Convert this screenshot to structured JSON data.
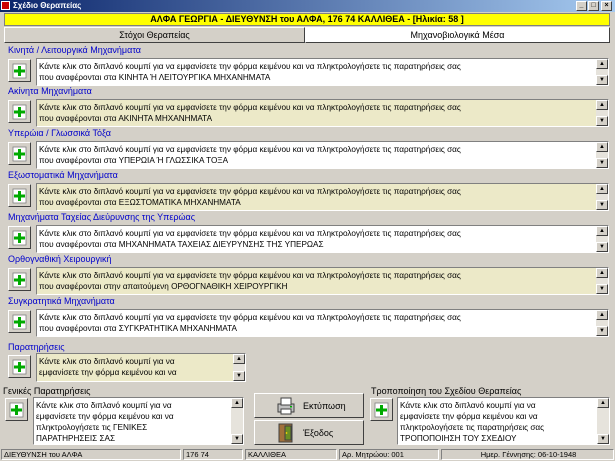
{
  "window": {
    "title": "Σχέδιο Θεραπείας"
  },
  "patient_header": "ΑΛΦΑ ΓΕΩΡΓΙΑ - ΔΙΕΥΘΥΝΣΗ του ΑΛΦΑ, 176 74 ΚΑΛΛΙΘΕΑ - [Ηλικία: 58 ]",
  "tabs": [
    {
      "label": "Στόχοι Θεραπείας",
      "active": false
    },
    {
      "label": "Μηχανοβιολογικά Μέσα",
      "active": true
    }
  ],
  "sections": [
    {
      "label": "Κινητά / Λειτουργικά Μηχανήματα",
      "line1": "Κάντε κλικ στο διπλανό κουμπί για να εμφανίσετε την φόρμα κειμένου και να πληκτρολογήσετε τις παρατηρήσεις σας",
      "line2": "που αναφέρονται στα ΚΙΝΗΤΑ Ή ΛΕΙΤΟΥΡΓΙΚΑ ΜΗΧΑΝΗΜΑΤΑ",
      "bg": "white"
    },
    {
      "label": "Ακίνητα Μηχανήματα",
      "line1": "Κάντε κλικ στο διπλανό κουμπί για να εμφανίσετε την φόρμα κειμένου και να πληκτρολογήσετε τις παρατηρήσεις σας",
      "line2": "που αναφέρονται στα ΑΚΙΝΗΤΑ ΜΗΧΑΝΗΜΑΤΑ",
      "bg": "beige"
    },
    {
      "label": "Υπερώια / Γλωσσικά Τόξα",
      "line1": "Κάντε κλικ στο διπλανό κουμπί για να εμφανίσετε την φόρμα κειμένου και να πληκτρολογήσετε τις παρατηρήσεις σας",
      "line2": "που αναφέρονται στα ΥΠΕΡΩΙΑ Ή ΓΛΩΣΣΙΚΑ ΤΟΞΑ",
      "bg": "white"
    },
    {
      "label": "Εξωστοματικά Μηχανήματα",
      "line1": "Κάντε κλικ στο διπλανό κουμπί για να εμφανίσετε την φόρμα κειμένου και να πληκτρολογήσετε τις παρατηρήσεις σας",
      "line2": "που αναφέρονται στα ΕΞΩΣΤΟΜΑΤΙΚΑ ΜΗΧΑΝΗΜΑΤΑ",
      "bg": "beige"
    },
    {
      "label": "Μηχανήματα Ταχείας Διεύρυνσης της Υπερώας",
      "line1": "Κάντε κλικ στο διπλανό κουμπί για να εμφανίσετε την φόρμα κειμένου και να πληκτρολογήσετε τις παρατηρήσεις σας",
      "line2": "που αναφέρονται στα ΜΗΧΑΝΗΜΑΤΑ ΤΑΧΕΙΑΣ ΔΙΕΥΡΥΝΣΗΣ ΤΗΣ ΥΠΕΡΩΑΣ",
      "bg": "white"
    },
    {
      "label": "Ορθογναθική Χειρουργική",
      "line1": "Κάντε κλικ στο διπλανό κουμπί για να εμφανίσετε την φόρμα κειμένου και να πληκτρολογήσετε τις παρατηρήσεις σας",
      "line2": "που αναφέρονται στην απαιτούμενη ΟΡΘΟΓΝΑΘΙΚΗ ΧΕΙΡΟΥΡΓΙΚΗ",
      "bg": "beige"
    },
    {
      "label": "Συγκρατητικά Μηχανήματα",
      "line1": "Κάντε κλικ στο διπλανό κουμπί για να εμφανίσετε την φόρμα κειμένου και να πληκτρολογήσετε τις παρατηρήσεις σας",
      "line2": "που αναφέρονται στα ΣΥΓΚΡΑΤΗΤΙΚΑ ΜΗΧΑΝΗΜΑΤΑ",
      "bg": "white"
    }
  ],
  "observations": {
    "label": "Παρατηρήσεις",
    "line1": "Κάντε κλικ στο διπλανό κουμπί για να",
    "line2": "εμφανίσετε την φόρμα κειμένου και να"
  },
  "general": {
    "label": "Γενικές Παρατηρήσεις",
    "lines": [
      "Κάντε κλικ στο διπλανό κουμπί για να",
      "εμφανίσετε την φόρμα κειμένου και να",
      "πληκτρολογήσετε τις   ΓΕΝΙΚΕΣ",
      "ΠΑΡΑΤΗΡΗΣΕΙΣ ΣΑΣ"
    ]
  },
  "modify": {
    "label": "Τροποποίηση του Σχεδίου Θεραπείας",
    "lines": [
      "Κάντε κλικ στο διπλανό κουμπί για να",
      "εμφανίσετε την φόρμα κειμένου και να",
      "πληκτρολογήσετε τις παρατηρήσεις σας",
      "ΤΡΟΠΟΠΟΙΗΣΗ ΤΟΥ ΣΧΕΔΙΟΥ"
    ]
  },
  "buttons": {
    "print": "Εκτύπωση",
    "exit": "Έξοδος"
  },
  "status": {
    "address": "ΔΙΕΥΘΥΝΣΗ του ΑΛΦΑ",
    "zip": "176 74",
    "city": "ΚΑΛΛΙΘΕΑ",
    "record": "Αρ. Μητρώου: 001",
    "birth": "Ημερ. Γέννησης: 06-10-1948"
  },
  "colors": {
    "section_label": "#0000cc",
    "memo_beige": "#ece9c8",
    "patient_bar": "#ffff00"
  }
}
